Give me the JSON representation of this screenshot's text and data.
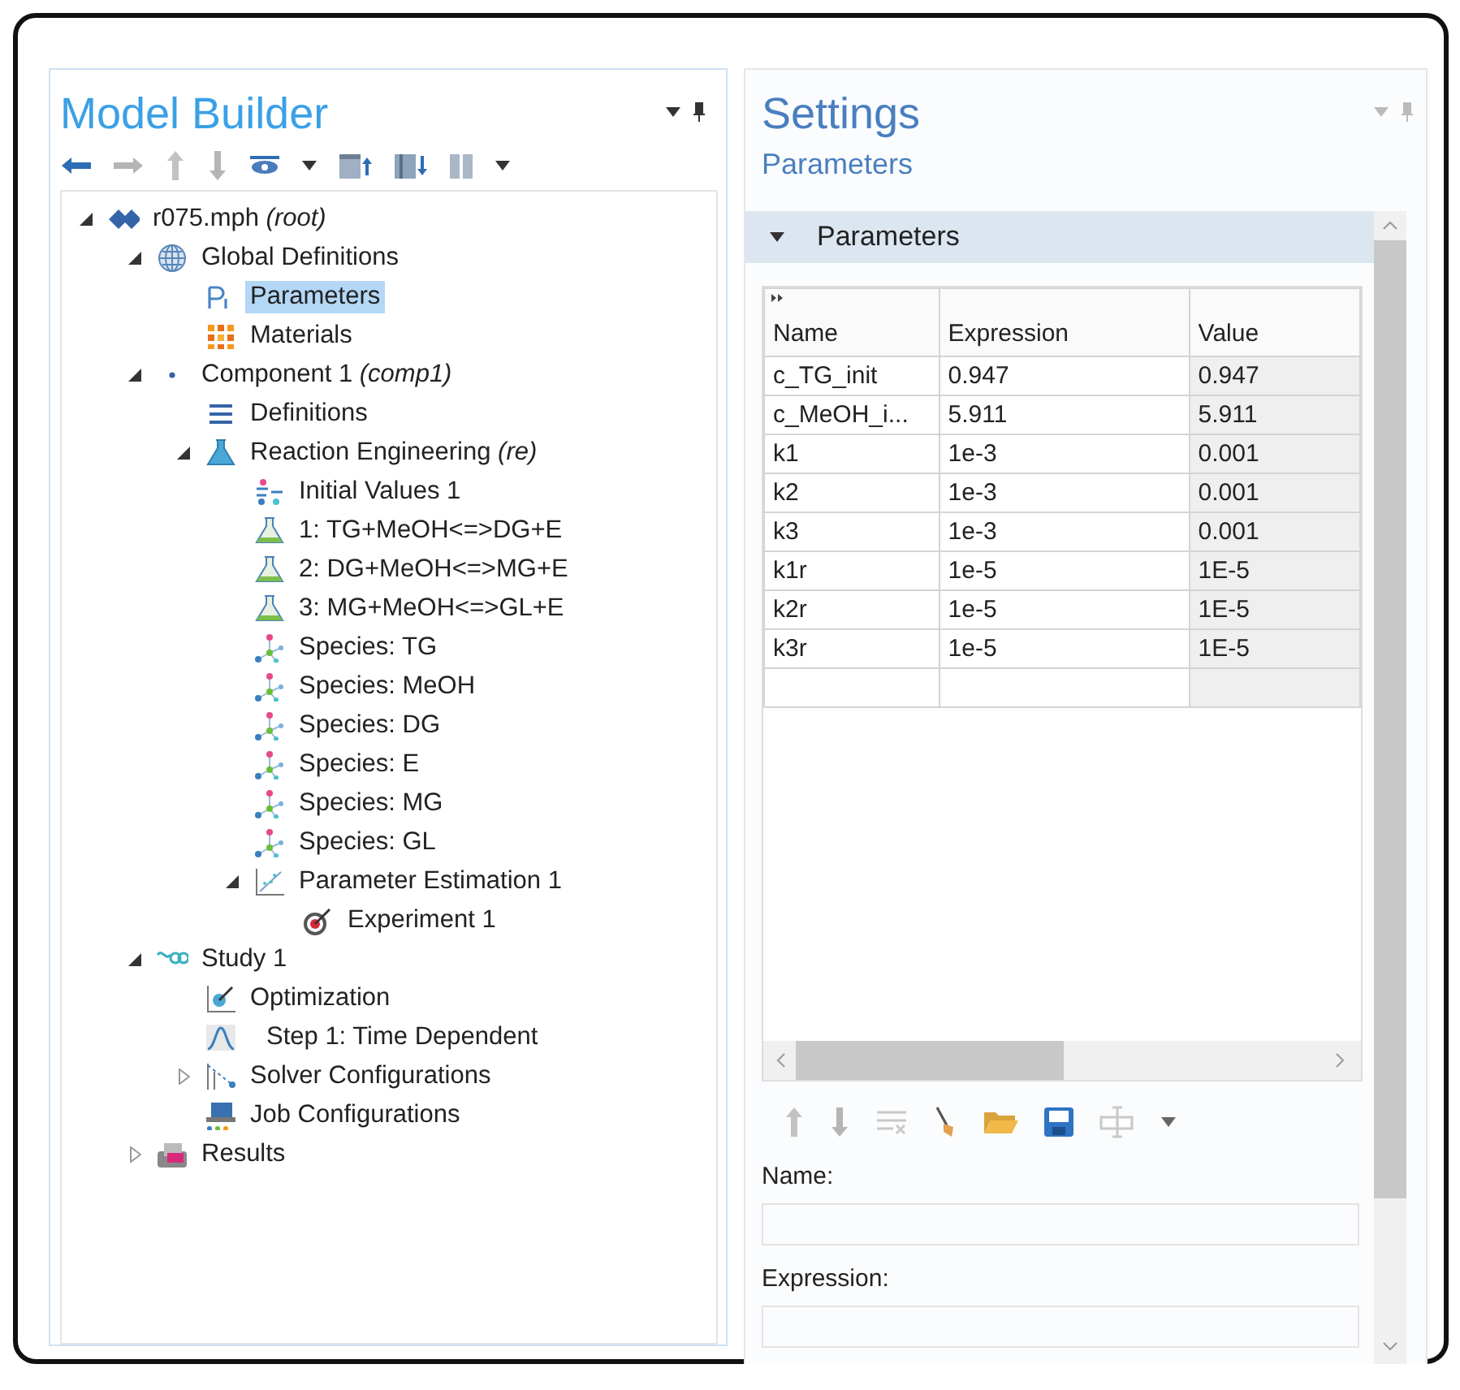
{
  "model_builder": {
    "title": "Model Builder",
    "tree": [
      {
        "kind": "root",
        "label": "r075.mph *(root)*",
        "expanded": true,
        "selected": false,
        "children": [
          {
            "kind": "globe",
            "label": "Global Definitions",
            "expanded": true,
            "selected": false,
            "children": [
              {
                "kind": "param",
                "label": "Parameters",
                "selected": true
              },
              {
                "kind": "material",
                "label": "Materials",
                "selected": false
              }
            ]
          },
          {
            "kind": "component",
            "label": "Component 1 *(comp1)*",
            "expanded": true,
            "selected": false,
            "children": [
              {
                "kind": "definitions",
                "label": "Definitions",
                "selected": false
              },
              {
                "kind": "flask",
                "label": "Reaction Engineering *(re)*",
                "expanded": true,
                "selected": false,
                "children": [
                  {
                    "kind": "initial",
                    "label": "Initial Values 1",
                    "selected": false
                  },
                  {
                    "kind": "reaction",
                    "label": "1: TG+MeOH<=>DG+E",
                    "selected": false
                  },
                  {
                    "kind": "reaction",
                    "label": "2: DG+MeOH<=>MG+E",
                    "selected": false
                  },
                  {
                    "kind": "reaction",
                    "label": "3: MG+MeOH<=>GL+E",
                    "selected": false
                  },
                  {
                    "kind": "species",
                    "label": "Species: TG",
                    "selected": false
                  },
                  {
                    "kind": "species",
                    "label": "Species: MeOH",
                    "selected": false
                  },
                  {
                    "kind": "species",
                    "label": "Species: DG",
                    "selected": false
                  },
                  {
                    "kind": "species",
                    "label": "Species: E",
                    "selected": false
                  },
                  {
                    "kind": "species",
                    "label": "Species: MG",
                    "selected": false
                  },
                  {
                    "kind": "species",
                    "label": "Species: GL",
                    "selected": false
                  },
                  {
                    "kind": "estimation",
                    "label": "Parameter Estimation 1",
                    "expanded": true,
                    "selected": false,
                    "children": [
                      {
                        "kind": "experiment",
                        "label": "Experiment 1",
                        "selected": false
                      }
                    ]
                  }
                ]
              }
            ]
          },
          {
            "kind": "study",
            "label": "Study 1",
            "expanded": true,
            "selected": false,
            "children": [
              {
                "kind": "optimization",
                "label": "Optimization",
                "selected": false
              },
              {
                "kind": "step",
                "label": "Step 1: Time Dependent",
                "selected": false
              },
              {
                "kind": "solver",
                "label": "Solver Configurations",
                "expanded": false,
                "selected": false
              },
              {
                "kind": "job",
                "label": "Job Configurations",
                "selected": false
              }
            ]
          },
          {
            "kind": "results",
            "label": "Results",
            "expanded": false,
            "selected": false
          }
        ]
      }
    ]
  },
  "settings": {
    "title": "Settings",
    "subtitle": "Parameters",
    "section": {
      "title": "Parameters",
      "expanded": true
    },
    "table": {
      "columns": [
        "Name",
        "Expression",
        "Value"
      ],
      "rows": [
        [
          "c_TG_init",
          "0.947",
          "0.947"
        ],
        [
          "c_MeOH_i...",
          "5.911",
          "5.911"
        ],
        [
          "k1",
          "1e-3",
          "0.001"
        ],
        [
          "k2",
          "1e-3",
          "0.001"
        ],
        [
          "k3",
          "1e-3",
          "0.001"
        ],
        [
          "k1r",
          "1e-5",
          "1E-5"
        ],
        [
          "k2r",
          "1e-5",
          "1E-5"
        ],
        [
          "k3r",
          "1e-5",
          "1E-5"
        ]
      ]
    },
    "fields": [
      {
        "label": "Name:"
      },
      {
        "label": "Expression:"
      }
    ]
  }
}
